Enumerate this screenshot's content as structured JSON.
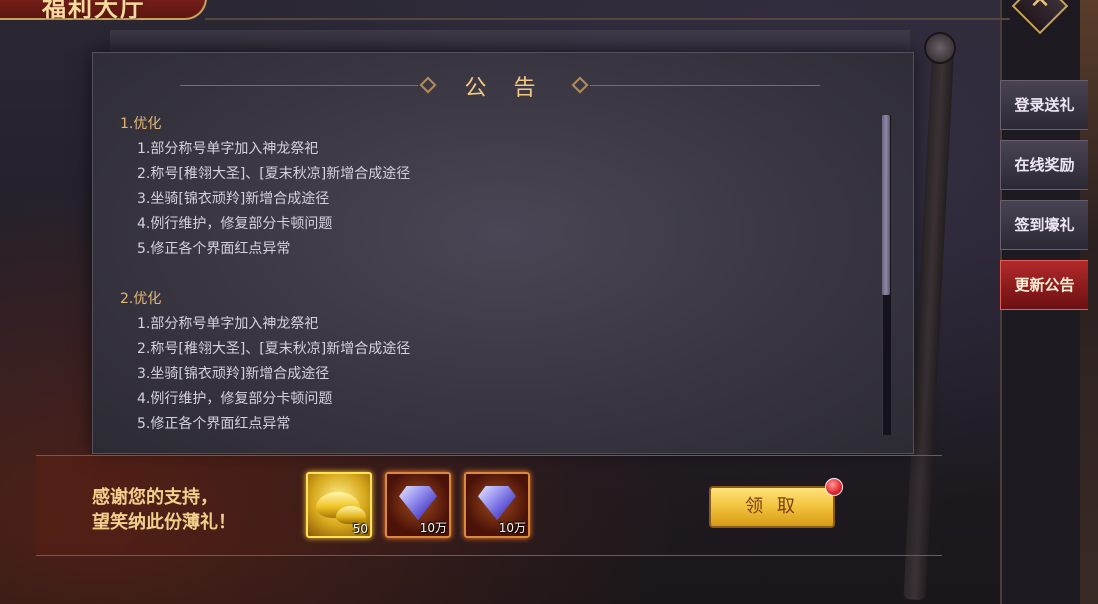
{
  "window": {
    "title": "福利大厅",
    "close_icon": "close-x-icon"
  },
  "announcement": {
    "heading": "公 告",
    "sections": [
      {
        "title": "1.优化",
        "items": [
          "1.部分称号单字加入神龙祭祀",
          "2.称号[稚翎大圣]、[夏末秋凉]新增合成途径",
          "3.坐骑[锦衣顽羚]新增合成途径",
          "4.例行维护，修复部分卡顿问题",
          "5.修正各个界面红点异常"
        ]
      },
      {
        "title": "2.优化",
        "items": [
          "1.部分称号单字加入神龙祭祀",
          "2.称号[稚翎大圣]、[夏末秋凉]新增合成途径",
          "3.坐骑[锦衣顽羚]新增合成途径",
          "4.例行维护，修复部分卡顿问题",
          "5.修正各个界面红点异常"
        ]
      }
    ]
  },
  "reward": {
    "thanks_line1": "感谢您的支持，",
    "thanks_line2": "望笑纳此份薄礼！",
    "items": [
      {
        "icon": "gold-ingot-icon",
        "qty": "50"
      },
      {
        "icon": "diamond-icon",
        "qty": "10万"
      },
      {
        "icon": "diamond-icon",
        "qty": "10万"
      }
    ],
    "claim_label": "领 取"
  },
  "side_tabs": [
    {
      "label": "登录送礼",
      "active": false
    },
    {
      "label": "在线奖励",
      "active": false
    },
    {
      "label": "签到壕礼",
      "active": false
    },
    {
      "label": "更新公告",
      "active": true
    }
  ]
}
